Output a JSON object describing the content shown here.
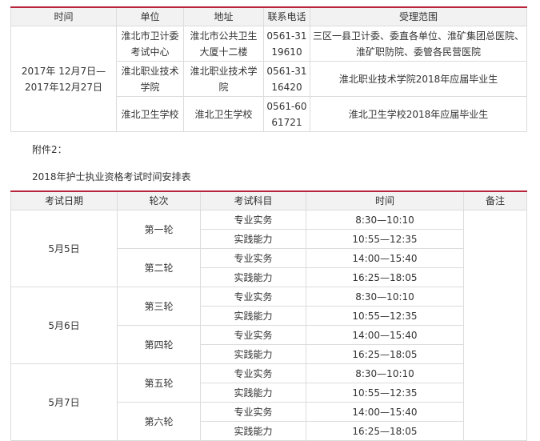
{
  "table1": {
    "headers": [
      "时间",
      "单位",
      "地址",
      "联系电话",
      "受理范围"
    ],
    "date_range": "2017年 12月7日—2017年12月27日",
    "rows": [
      {
        "unit": "淮北市卫计委考试中心",
        "address": "淮北市公共卫生大厦十二楼",
        "phone": "0561-3119610",
        "scope": "三区一县卫计委、委直各单位、淮矿集团总医院、淮矿职防院、委管各民营医院"
      },
      {
        "unit": "淮北职业技术学院",
        "address": "淮北职业技术学院",
        "phone": "0561-3116420",
        "scope": "淮北职业技术学院2018年应届毕业生"
      },
      {
        "unit": "淮北卫生学校",
        "address": "淮北卫生学校",
        "phone": "0561-6061721",
        "scope": "淮北卫生学校2018年应届毕业生"
      }
    ]
  },
  "attachment_label": "附件2：",
  "schedule_title": "2018年护士执业资格考试时间安排表",
  "table2": {
    "headers": [
      "考试日期",
      "轮次",
      "考试科目",
      "时间",
      "备注"
    ],
    "days": [
      {
        "date": "5月5日",
        "rounds": [
          {
            "round": "第一轮",
            "sessions": [
              {
                "subject": "专业实务",
                "time": "8:30—10:10"
              },
              {
                "subject": "实践能力",
                "time": "10:55—12:35"
              }
            ]
          },
          {
            "round": "第二轮",
            "sessions": [
              {
                "subject": "专业实务",
                "time": "14:00—15:40"
              },
              {
                "subject": "实践能力",
                "time": "16:25—18:05"
              }
            ]
          }
        ]
      },
      {
        "date": "5月6日",
        "rounds": [
          {
            "round": "第三轮",
            "sessions": [
              {
                "subject": "专业实务",
                "time": "8:30—10:10"
              },
              {
                "subject": "实践能力",
                "time": "10:55—12:35"
              }
            ]
          },
          {
            "round": "第四轮",
            "sessions": [
              {
                "subject": "专业实务",
                "time": "14:00—15:40"
              },
              {
                "subject": "实践能力",
                "time": "16:25—18:05"
              }
            ]
          }
        ]
      },
      {
        "date": "5月7日",
        "rounds": [
          {
            "round": "第五轮",
            "sessions": [
              {
                "subject": "专业实务",
                "time": "8:30—10:10"
              },
              {
                "subject": "实践能力",
                "time": "10:55—12:35"
              }
            ]
          },
          {
            "round": "第六轮",
            "sessions": [
              {
                "subject": "专业实务",
                "time": "14:00—15:40"
              },
              {
                "subject": "实践能力",
                "time": "16:25—18:05"
              }
            ]
          }
        ]
      }
    ]
  },
  "colors": {
    "accent_border": "#b8243c",
    "header_bg": "#f2f2f2",
    "grid": "#dcdcdc"
  }
}
